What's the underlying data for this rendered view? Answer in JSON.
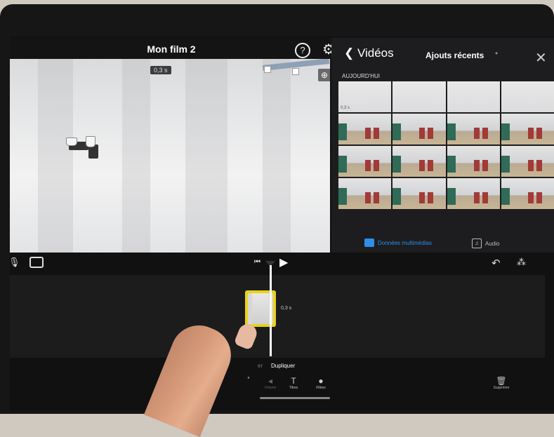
{
  "header": {
    "title": "Mon film 2",
    "help_icon": "?",
    "settings_icon": "⚙"
  },
  "viewer": {
    "duration_badge": "0,3 s",
    "zoom_icon": "⊕"
  },
  "browser": {
    "back_label": "❮ Vidéos",
    "album": "Ajouts récents",
    "dot": "•",
    "close": "✕",
    "section": "AUJOURD'HUI",
    "first_thumb_badge": "0,3 s"
  },
  "bottom_tabs": {
    "media_label": "Données multimédias",
    "audio_label": "Audio"
  },
  "controls": {
    "mic_icon": "🎙",
    "skip_icon": "⏮",
    "play_icon": "▶",
    "undo_icon": "↶",
    "waveform_icon": "⁂"
  },
  "timeline": {
    "clip_duration": "0,3 s"
  },
  "actions": {
    "partial_left": "er",
    "duplicate": "Dupliquer",
    "tools": [
      {
        "glyph": "",
        "label": "e"
      },
      {
        "glyph": "◂",
        "label": "Volume"
      },
      {
        "glyph": "T",
        "label": "Titres"
      },
      {
        "glyph": "●",
        "label": "Filtres"
      }
    ],
    "delete_glyph": "🗑",
    "delete_label": "Supprimer"
  },
  "colors": {
    "accent": "#2e8fe8",
    "clip_border": "#e9d21a"
  }
}
